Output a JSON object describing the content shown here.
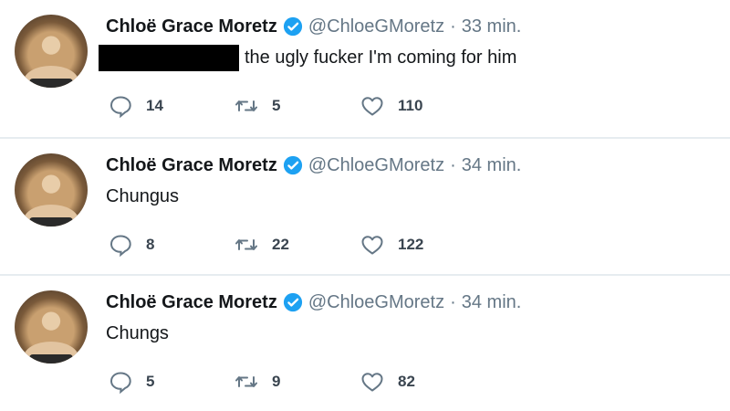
{
  "tweets": [
    {
      "name": "Chloë Grace Moretz",
      "handle": "@ChloeGMoretz",
      "time": "33 min.",
      "text": "the ugly fucker I'm coming for him",
      "redacted": true,
      "replies": "14",
      "retweets": "5",
      "likes": "110"
    },
    {
      "name": "Chloë Grace Moretz",
      "handle": "@ChloeGMoretz",
      "time": "34 min.",
      "text": "Chungus",
      "redacted": false,
      "replies": "8",
      "retweets": "22",
      "likes": "122"
    },
    {
      "name": "Chloë Grace Moretz",
      "handle": "@ChloeGMoretz",
      "time": "34 min.",
      "text": "Chungs",
      "redacted": false,
      "replies": "5",
      "retweets": "9",
      "likes": "82"
    }
  ],
  "separator": "·",
  "colors": {
    "verified": "#1da1f2",
    "muted": "#657786",
    "divider": "#e6ecf0"
  },
  "icons": {
    "reply": "reply-icon",
    "retweet": "retweet-icon",
    "like": "heart-icon",
    "verified": "verified-badge-icon"
  }
}
